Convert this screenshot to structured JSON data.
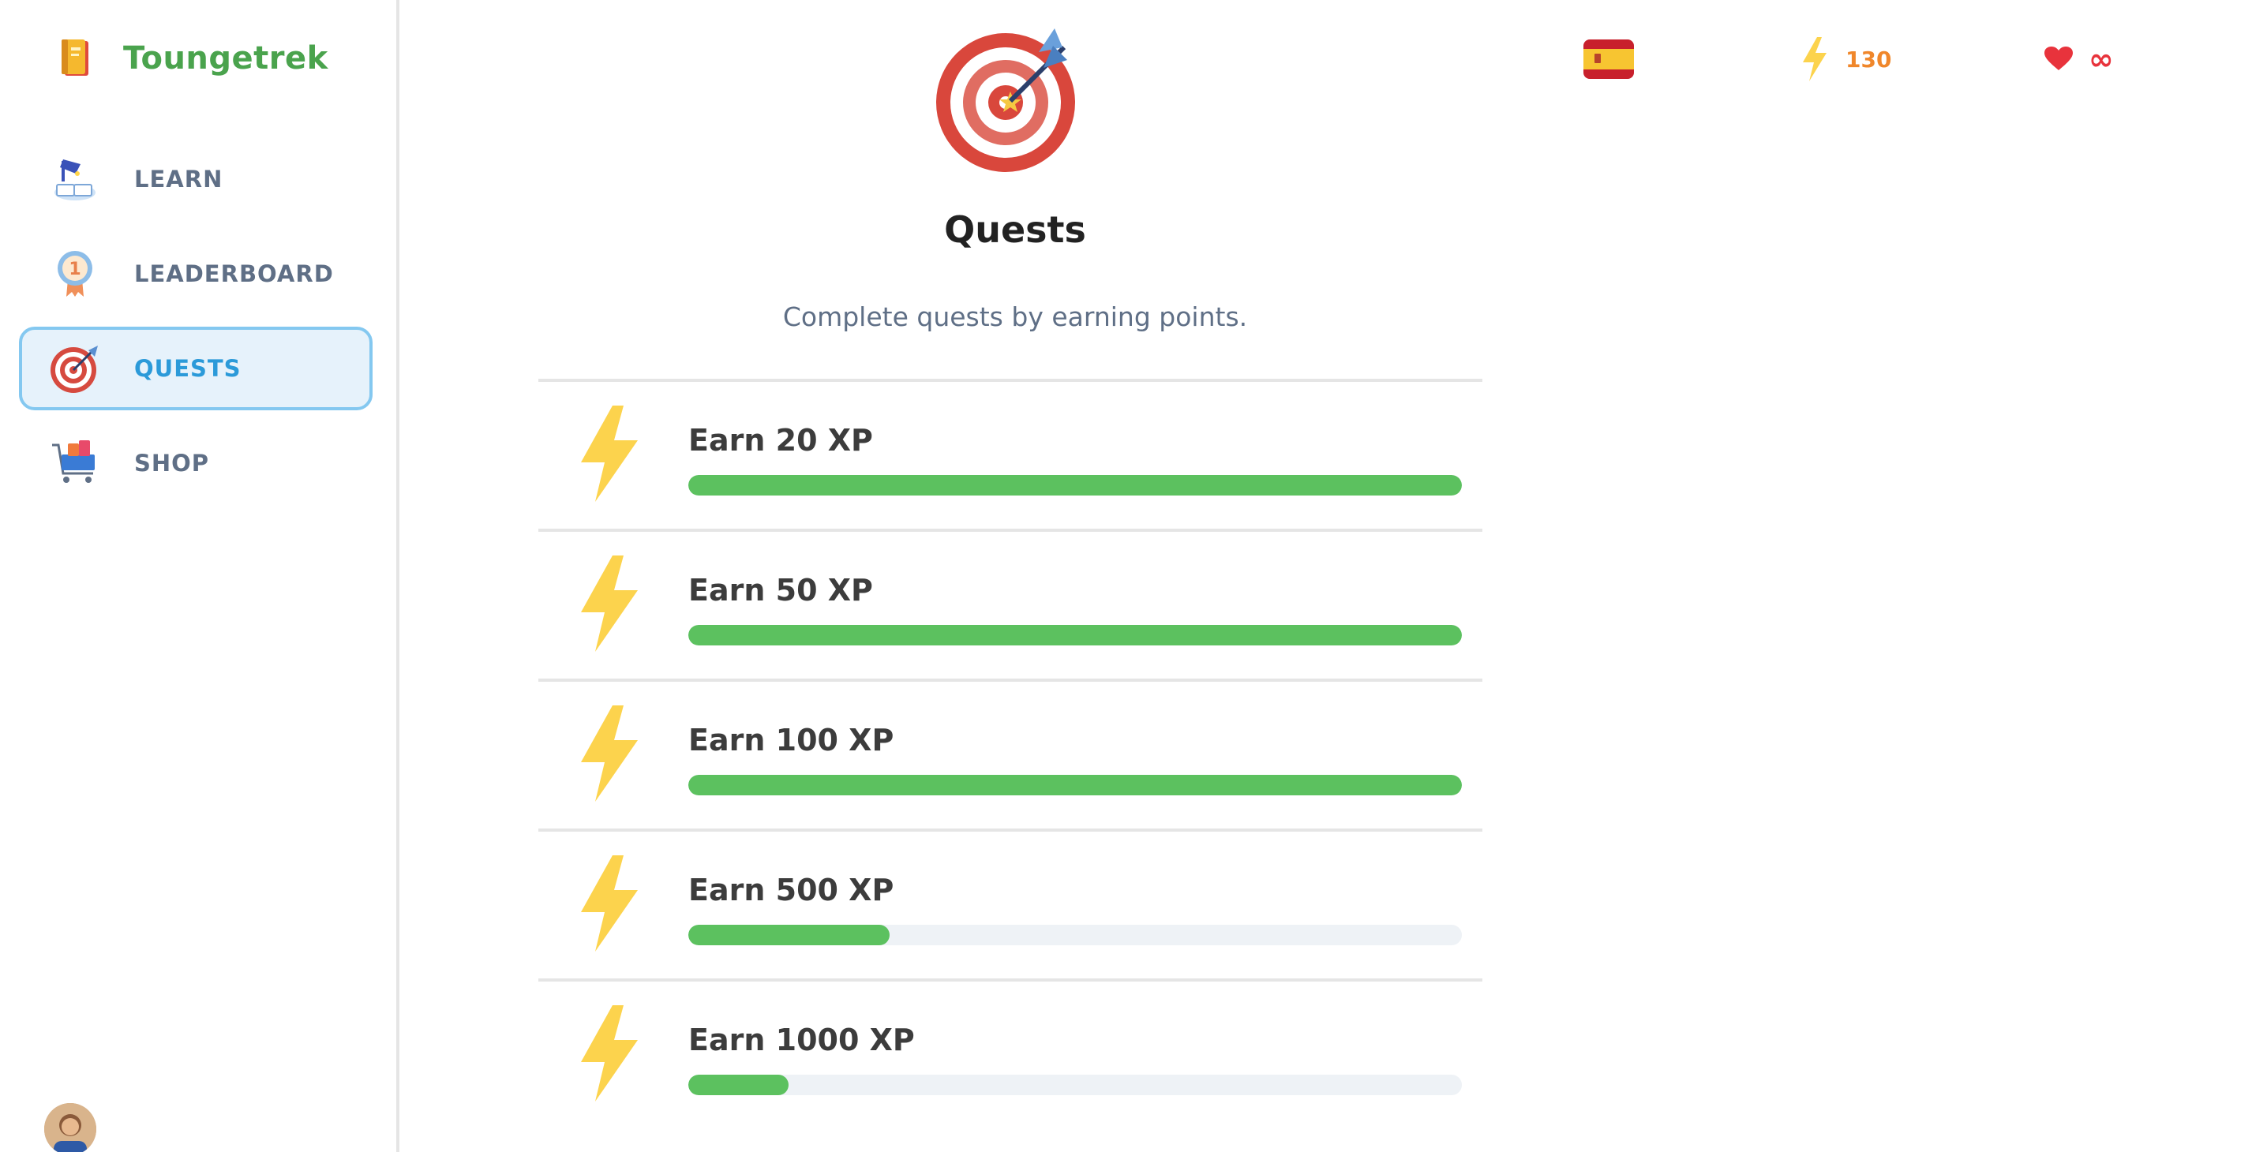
{
  "app": {
    "brand_name": "Toungetrek",
    "brand_color": "#4aa34d"
  },
  "sidebar": {
    "items": [
      {
        "label": "LEARN",
        "icon": "learn-lamp-icon",
        "active": false
      },
      {
        "label": "LEADERBOARD",
        "icon": "medal-icon",
        "active": false
      },
      {
        "label": "QUESTS",
        "icon": "target-icon",
        "active": true
      },
      {
        "label": "SHOP",
        "icon": "shopping-cart-icon",
        "active": false
      }
    ],
    "active_color": "#2b9ad9"
  },
  "stats": {
    "language_flag": "spain-flag-icon",
    "xp": "130",
    "hearts": "∞"
  },
  "main": {
    "title": "Quests",
    "subtitle": "Complete quests by earning points.",
    "quests": [
      {
        "title": "Earn 20 XP",
        "progress": 1.0
      },
      {
        "title": "Earn 50 XP",
        "progress": 1.0
      },
      {
        "title": "Earn 100 XP",
        "progress": 1.0
      },
      {
        "title": "Earn 500 XP",
        "progress": 0.26
      },
      {
        "title": "Earn 1000 XP",
        "progress": 0.13
      }
    ],
    "progress_color": "#5cc15f"
  }
}
